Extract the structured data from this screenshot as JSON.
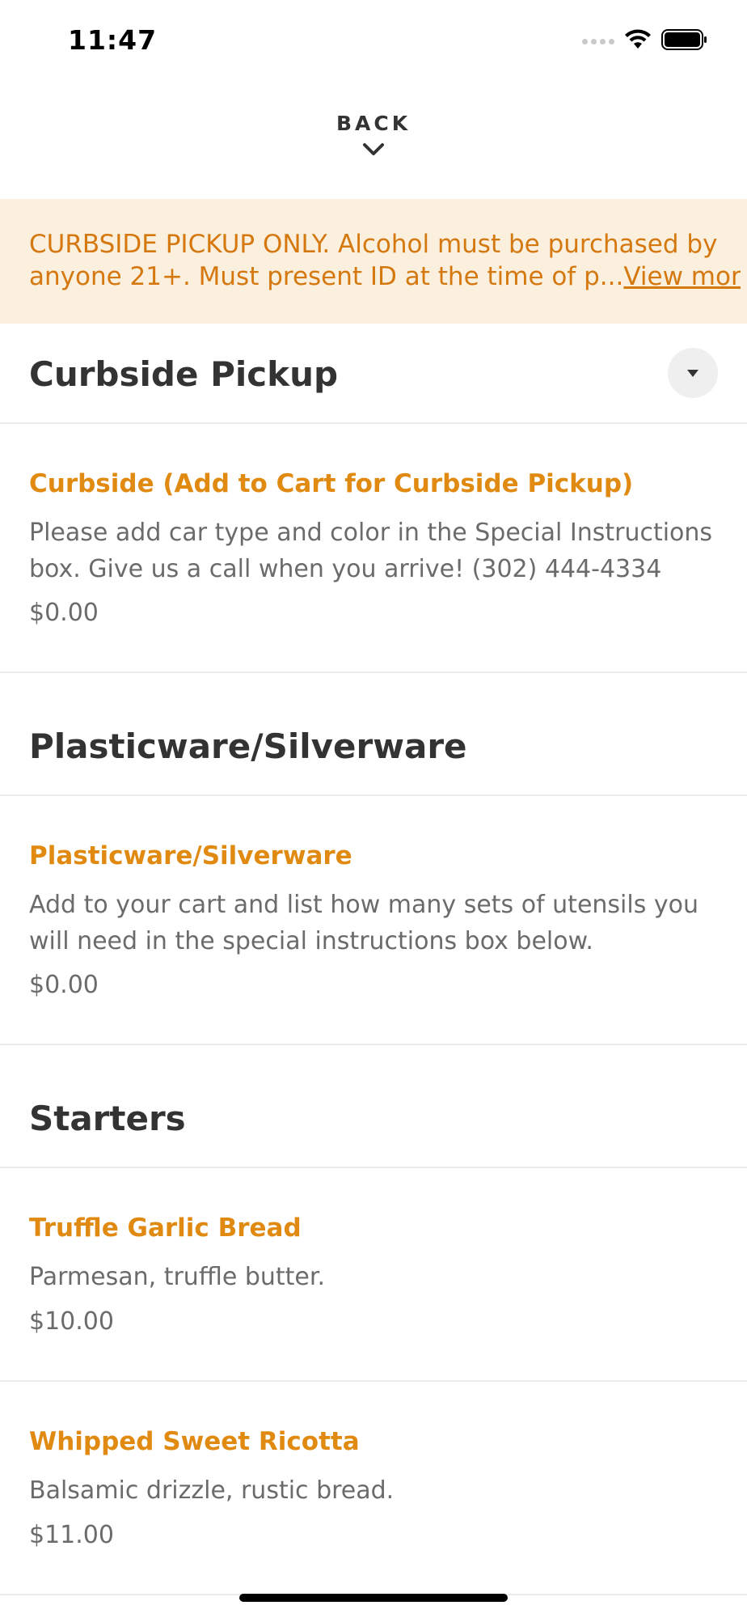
{
  "status_bar": {
    "time": "11:47",
    "icons": [
      "cellular-signal-icon",
      "wifi-icon",
      "battery-icon"
    ]
  },
  "header": {
    "back_label": "BACK",
    "back_icon": "chevron-down-icon"
  },
  "notice": {
    "line1": "CURBSIDE PICKUP ONLY. Alcohol must be purchased by",
    "line2": "anyone 21+. Must present ID at the time of p...",
    "link": "View more"
  },
  "sections": {
    "curbside": {
      "title": "Curbside Pickup",
      "toggle_icon": "caret-down-icon",
      "items": [
        {
          "name": "Curbside (Add to Cart for Curbside Pickup)",
          "description": "Please add car type and color in the Special Instructions box. Give us a call when you arrive! (302) 444-4334",
          "price": "$0.00"
        }
      ]
    },
    "plasticware": {
      "title": "Plasticware/Silverware",
      "items": [
        {
          "name": "Plasticware/Silverware",
          "description": "Add to your cart and list how many sets of utensils you will need in the special instructions box below.",
          "price": "$0.00"
        }
      ]
    },
    "starters": {
      "title": "Starters",
      "items": [
        {
          "name": "Truffle Garlic Bread",
          "description": "Parmesan, truffle butter.",
          "price": "$10.00"
        },
        {
          "name": "Whipped Sweet Ricotta",
          "description": "Balsamic drizzle, rustic bread.",
          "price": "$11.00"
        }
      ]
    }
  },
  "colors": {
    "accent": "#e08a12",
    "notice_bg": "#fbf0de",
    "notice_text": "#d4780f",
    "heading": "#333333",
    "body_text": "#6b6b6b"
  }
}
